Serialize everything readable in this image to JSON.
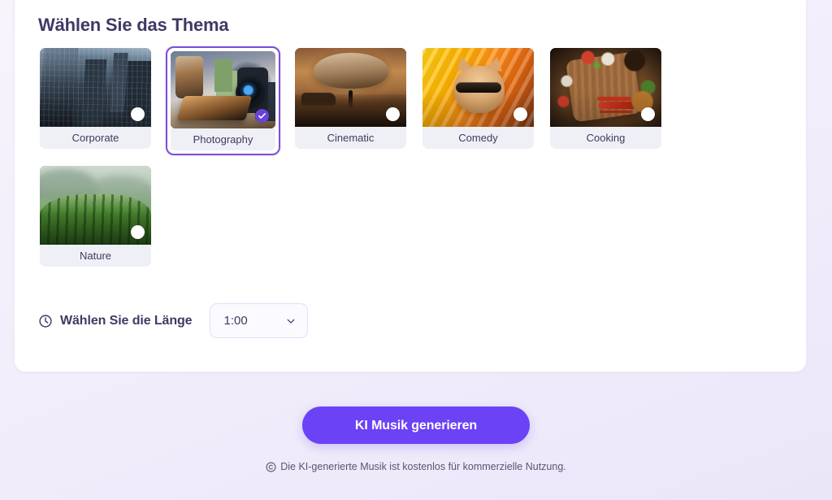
{
  "panel": {
    "section_title": "Wählen Sie das Thema"
  },
  "themes": [
    {
      "label": "Corporate",
      "art": "corporate",
      "selected": false,
      "indicator": "radio-unselected"
    },
    {
      "label": "Photography",
      "art": "photography",
      "selected": true,
      "indicator": "check-selected"
    },
    {
      "label": "Cinematic",
      "art": "cinematic",
      "selected": false,
      "indicator": "radio-unselected"
    },
    {
      "label": "Comedy",
      "art": "comedy",
      "selected": false,
      "indicator": "radio-unselected"
    },
    {
      "label": "Cooking",
      "art": "cooking",
      "selected": false,
      "indicator": "radio-unselected"
    },
    {
      "label": "Nature",
      "art": "nature",
      "selected": false,
      "indicator": "radio-unselected"
    }
  ],
  "length": {
    "icon": "clock-icon",
    "label": "Wählen Sie die Länge",
    "value": "1:00",
    "chevron": "chevron-down-icon"
  },
  "cta": {
    "button_label": "KI Musik generieren",
    "disclaimer_icon": "copyright-icon",
    "disclaimer": "Die KI-generierte Musik ist kostenlos für kommerzielle Nutzung."
  },
  "colors": {
    "accent": "#6b42f5",
    "selected_border": "#7c4ddb",
    "heading": "#403963",
    "panel_bg": "#ffffff",
    "page_bg": "#eeeafa",
    "card_label_bg": "#eef0f6"
  }
}
